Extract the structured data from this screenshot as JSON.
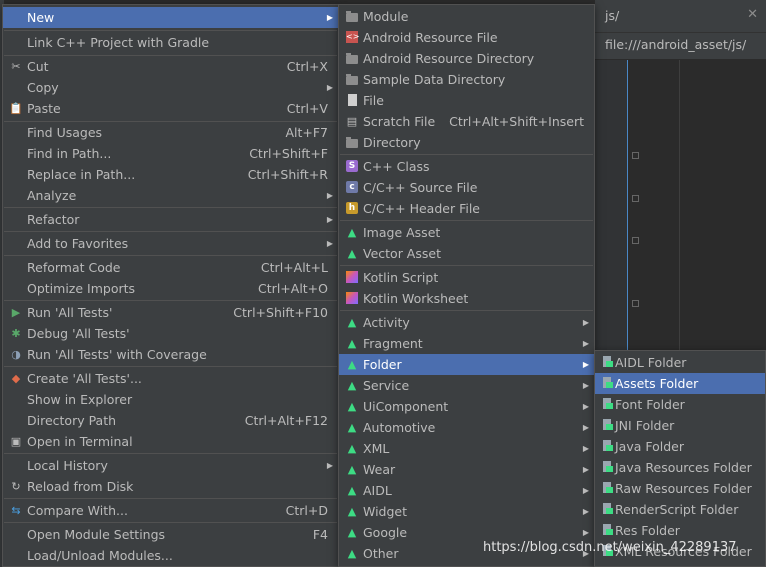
{
  "editor": {
    "tab_title": "js/",
    "tab_close": "✕",
    "path": "file:///android_asset/js/"
  },
  "menu1": {
    "items": [
      {
        "label": "New",
        "submenu": true,
        "selected": true
      },
      {
        "label": "Link C++ Project with Gradle"
      },
      {
        "label": "Cut",
        "shortcut": "Ctrl+X",
        "icon": "cut-icon"
      },
      {
        "label": "Copy",
        "submenu": true
      },
      {
        "label": "Paste",
        "shortcut": "Ctrl+V",
        "icon": "paste-icon"
      },
      {
        "label": "Find Usages",
        "shortcut": "Alt+F7"
      },
      {
        "label": "Find in Path...",
        "shortcut": "Ctrl+Shift+F"
      },
      {
        "label": "Replace in Path...",
        "shortcut": "Ctrl+Shift+R"
      },
      {
        "label": "Analyze",
        "submenu": true
      },
      {
        "label": "Refactor",
        "submenu": true
      },
      {
        "label": "Add to Favorites",
        "submenu": true
      },
      {
        "label": "Reformat Code",
        "shortcut": "Ctrl+Alt+L"
      },
      {
        "label": "Optimize Imports",
        "shortcut": "Ctrl+Alt+O"
      },
      {
        "label": "Run 'All Tests'",
        "shortcut": "Ctrl+Shift+F10",
        "icon": "run-icon"
      },
      {
        "label": "Debug 'All Tests'",
        "icon": "debug-icon"
      },
      {
        "label": "Run 'All Tests' with Coverage",
        "icon": "coverage-icon"
      },
      {
        "label": "Create 'All Tests'...",
        "icon": "create-test-icon"
      },
      {
        "label": "Show in Explorer"
      },
      {
        "label": "Directory Path",
        "shortcut": "Ctrl+Alt+F12"
      },
      {
        "label": "Open in Terminal",
        "icon": "terminal-icon"
      },
      {
        "label": "Local History",
        "submenu": true
      },
      {
        "label": "Reload from Disk",
        "icon": "reload-icon"
      },
      {
        "label": "Compare With...",
        "shortcut": "Ctrl+D",
        "icon": "compare-icon"
      },
      {
        "label": "Open Module Settings",
        "shortcut": "F4"
      },
      {
        "label": "Load/Unload Modules..."
      }
    ]
  },
  "menu2": {
    "items": [
      {
        "label": "Module",
        "icon": "module-folder-icon"
      },
      {
        "label": "Android Resource File",
        "icon": "android-resource-file-icon"
      },
      {
        "label": "Android Resource Directory",
        "icon": "folder-icon"
      },
      {
        "label": "Sample Data Directory",
        "icon": "folder-icon"
      },
      {
        "label": "File",
        "icon": "file-icon"
      },
      {
        "label": "Scratch File",
        "shortcut": "Ctrl+Alt+Shift+Insert",
        "icon": "scratch-file-icon"
      },
      {
        "label": "Directory",
        "icon": "folder-icon"
      },
      {
        "label": "C++ Class",
        "icon": "cpp-class-icon"
      },
      {
        "label": "C/C++ Source File",
        "icon": "cpp-source-icon"
      },
      {
        "label": "C/C++ Header File",
        "icon": "cpp-header-icon"
      },
      {
        "label": "Image Asset",
        "icon": "android-icon"
      },
      {
        "label": "Vector Asset",
        "icon": "android-icon"
      },
      {
        "label": "Kotlin Script",
        "icon": "kotlin-icon"
      },
      {
        "label": "Kotlin Worksheet",
        "icon": "kotlin-icon"
      },
      {
        "label": "Activity",
        "submenu": true,
        "icon": "android-icon"
      },
      {
        "label": "Fragment",
        "submenu": true,
        "icon": "android-icon"
      },
      {
        "label": "Folder",
        "submenu": true,
        "selected": true,
        "icon": "android-icon"
      },
      {
        "label": "Service",
        "submenu": true,
        "icon": "android-icon"
      },
      {
        "label": "UiComponent",
        "submenu": true,
        "icon": "android-icon"
      },
      {
        "label": "Automotive",
        "submenu": true,
        "icon": "android-icon"
      },
      {
        "label": "XML",
        "submenu": true,
        "icon": "android-icon"
      },
      {
        "label": "Wear",
        "submenu": true,
        "icon": "android-icon"
      },
      {
        "label": "AIDL",
        "submenu": true,
        "icon": "android-icon"
      },
      {
        "label": "Widget",
        "submenu": true,
        "icon": "android-icon"
      },
      {
        "label": "Google",
        "submenu": true,
        "icon": "android-icon"
      },
      {
        "label": "Other",
        "submenu": true,
        "icon": "android-icon"
      }
    ]
  },
  "menu3": {
    "items": [
      {
        "label": "AIDL Folder"
      },
      {
        "label": "Assets Folder",
        "selected": true
      },
      {
        "label": "Font Folder"
      },
      {
        "label": "JNI Folder"
      },
      {
        "label": "Java Folder"
      },
      {
        "label": "Java Resources Folder"
      },
      {
        "label": "Raw Resources Folder"
      },
      {
        "label": "RenderScript Folder"
      },
      {
        "label": "Res Folder"
      },
      {
        "label": "XML Resources Folder"
      }
    ]
  },
  "watermark": "https://blog.csdn.net/weixin_42289137",
  "colors": {
    "menu_bg": "#3c3f41",
    "selection": "#4b6eaf",
    "android_green": "#3ddc84"
  }
}
